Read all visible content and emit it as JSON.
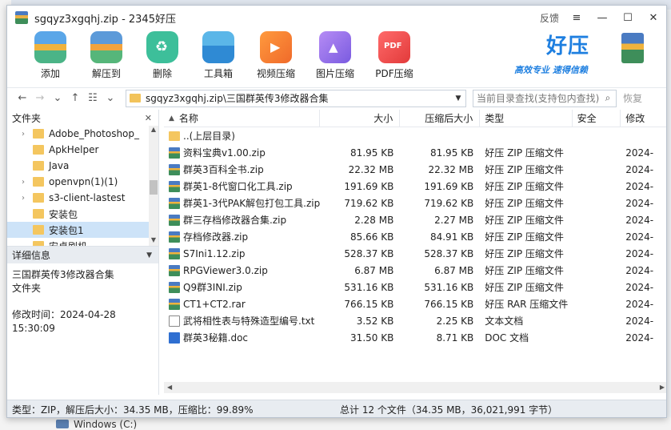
{
  "window": {
    "title": "sgqyz3xgqhj.zip - 2345好压",
    "feedback": "反馈",
    "menu_glyph": "≡",
    "minimize_glyph": "—",
    "maximize_glyph": "☐",
    "close_glyph": "✕"
  },
  "toolbar": {
    "add": "添加",
    "extract": "解压到",
    "delete": "删除",
    "toolbox": "工具箱",
    "video": "视频压缩",
    "image": "图片压缩",
    "pdf": "PDF压缩",
    "brand_name": "好压",
    "brand_slogan": "高效专业 速得信赖"
  },
  "address": {
    "back": "←",
    "forward": "→",
    "history": "⌄",
    "up": "↑",
    "view": "☷",
    "view_dd": "⌄",
    "path": "sgqyz3xgqhj.zip\\三国群英传3修改器合集",
    "search_placeholder": "当前目录查找(支持包内查找)",
    "restore": "恢复"
  },
  "left": {
    "folder_header": "文件夹",
    "folder_close": "✕",
    "tree": [
      {
        "label": "Adobe_Photoshop_",
        "expandable": true
      },
      {
        "label": "ApkHelper",
        "expandable": false
      },
      {
        "label": "Java",
        "expandable": false
      },
      {
        "label": "openvpn(1)(1)",
        "expandable": true
      },
      {
        "label": "s3-client-lastest",
        "expandable": true
      },
      {
        "label": "安装包",
        "expandable": false
      },
      {
        "label": "安装包1",
        "expandable": false,
        "selected": true
      },
      {
        "label": "安卓刷机",
        "expandable": false
      }
    ],
    "detail_header": "详细信息",
    "detail_name": "三国群英传3修改器合集",
    "detail_kind": "文件夹",
    "detail_modified": "修改时间：2024-04-28 15:30:09"
  },
  "columns": {
    "name": "名称",
    "size": "大小",
    "compressed": "压缩后大小",
    "type": "类型",
    "security": "安全",
    "modified": "修改"
  },
  "files": [
    {
      "name": "..(上层目录)",
      "size": "",
      "compressed": "",
      "type": "",
      "modified": "",
      "icon": "up"
    },
    {
      "name": "资料宝典v1.00.zip",
      "size": "81.95 KB",
      "compressed": "81.95 KB",
      "type": "好压 ZIP 压缩文件",
      "modified": "2024-",
      "icon": "zip"
    },
    {
      "name": "群英3百科全书.zip",
      "size": "22.32 MB",
      "compressed": "22.32 MB",
      "type": "好压 ZIP 压缩文件",
      "modified": "2024-",
      "icon": "zip"
    },
    {
      "name": "群英1-8代窗口化工具.zip",
      "size": "191.69 KB",
      "compressed": "191.69 KB",
      "type": "好压 ZIP 压缩文件",
      "modified": "2024-",
      "icon": "zip"
    },
    {
      "name": "群英1-3代PAK解包打包工具.zip",
      "size": "719.62 KB",
      "compressed": "719.62 KB",
      "type": "好压 ZIP 压缩文件",
      "modified": "2024-",
      "icon": "zip"
    },
    {
      "name": "群三存档修改器合集.zip",
      "size": "2.28 MB",
      "compressed": "2.27 MB",
      "type": "好压 ZIP 压缩文件",
      "modified": "2024-",
      "icon": "zip"
    },
    {
      "name": "存档修改器.zip",
      "size": "85.66 KB",
      "compressed": "84.91 KB",
      "type": "好压 ZIP 压缩文件",
      "modified": "2024-",
      "icon": "zip"
    },
    {
      "name": "S7Ini1.12.zip",
      "size": "528.37 KB",
      "compressed": "528.37 KB",
      "type": "好压 ZIP 压缩文件",
      "modified": "2024-",
      "icon": "zip"
    },
    {
      "name": "RPGViewer3.0.zip",
      "size": "6.87 MB",
      "compressed": "6.87 MB",
      "type": "好压 ZIP 压缩文件",
      "modified": "2024-",
      "icon": "zip"
    },
    {
      "name": "Q9群3INI.zip",
      "size": "531.16 KB",
      "compressed": "531.16 KB",
      "type": "好压 ZIP 压缩文件",
      "modified": "2024-",
      "icon": "zip"
    },
    {
      "name": "CT1+CT2.rar",
      "size": "766.15 KB",
      "compressed": "766.15 KB",
      "type": "好压 RAR 压缩文件",
      "modified": "2024-",
      "icon": "zip"
    },
    {
      "name": "武将相性表与特殊造型编号.txt",
      "size": "3.52 KB",
      "compressed": "2.25 KB",
      "type": "文本文档",
      "modified": "2024-",
      "icon": "txt"
    },
    {
      "name": "群英3秘籍.doc",
      "size": "31.50 KB",
      "compressed": "8.71 KB",
      "type": "DOC 文档",
      "modified": "2024-",
      "icon": "doc"
    }
  ],
  "status": {
    "left": "类型：ZIP，解压后大小：34.35 MB，压缩比：99.89%",
    "right": "总计 12 个文件（34.35 MB，36,021,991 字节）"
  },
  "background": {
    "drive": "Windows (C:)"
  }
}
